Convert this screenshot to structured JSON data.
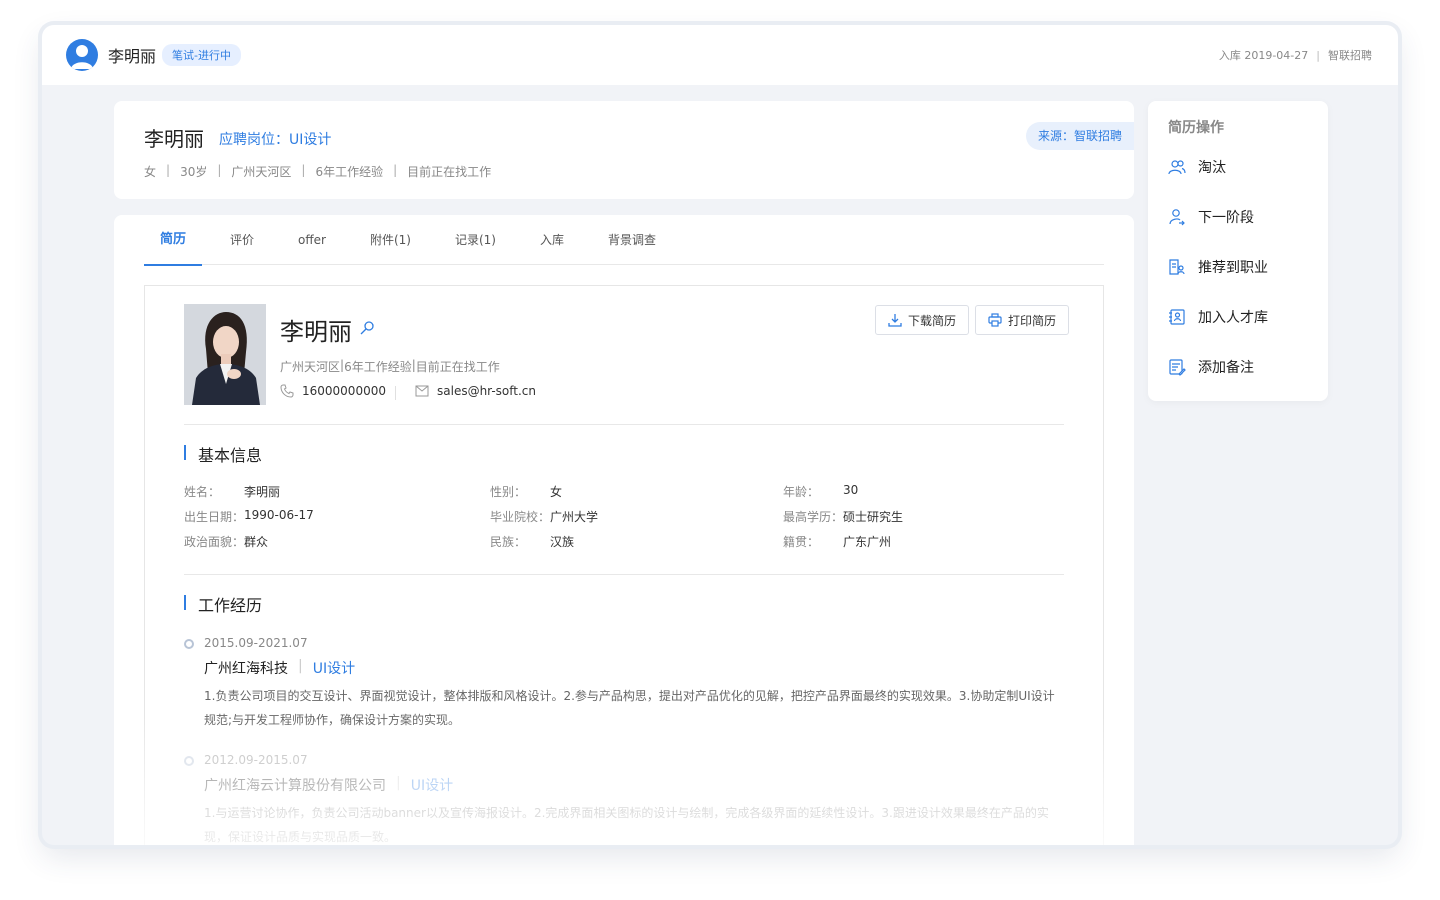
{
  "topbar": {
    "name": "李明丽",
    "status": "笔试-进行中",
    "entry_date": "入库 2019-04-27",
    "sep": "|",
    "source": "智联招聘"
  },
  "summary": {
    "name": "李明丽",
    "position": "应聘岗位：UI设计",
    "source_tag": "来源：智联招聘",
    "meta": [
      "女",
      "30岁",
      "广州天河区",
      "6年工作经验",
      "目前正在找工作"
    ],
    "meta_sep": "|"
  },
  "tabs": [
    {
      "label": "简历"
    },
    {
      "label": "评价"
    },
    {
      "label": "offer"
    },
    {
      "label": "附件(1)"
    },
    {
      "label": "记录(1)"
    },
    {
      "label": "入库"
    },
    {
      "label": "背景调查"
    }
  ],
  "resume": {
    "name": "李明丽",
    "meta": [
      "广州天河区",
      "6年工作经验",
      "目前正在找工作"
    ],
    "phone": "16000000000",
    "email": "sales@hr-soft.cn",
    "download_label": "下载简历",
    "print_label": "打印简历",
    "basic_title": "基本信息",
    "basic_info": [
      [
        [
          "姓名：",
          "李明丽"
        ],
        [
          "性别：",
          "女"
        ],
        [
          "年龄：",
          "30"
        ]
      ],
      [
        [
          "出生日期：",
          "1990-06-17"
        ],
        [
          "毕业院校：",
          "广州大学"
        ],
        [
          "最高学历：",
          "硕士研究生"
        ]
      ],
      [
        [
          "政治面貌：",
          "群众"
        ],
        [
          "民族：",
          "汉族"
        ],
        [
          "籍贯：",
          "广东广州"
        ]
      ]
    ],
    "work_title": "工作经历",
    "work": [
      {
        "date": "2015.09-2021.07",
        "company": "广州红海科技",
        "role": "UI设计",
        "desc": "1.负责公司项目的交互设计、界面视觉设计，整体排版和风格设计。2.参与产品构思，提出对产品优化的见解，把控产品界面最终的实现效果。3.协助定制UI设计规范;与开发工程师协作，确保设计方案的实现。"
      },
      {
        "date": "2012.09-2015.07",
        "company": "广州红海云计算股份有限公司",
        "role": "UI设计",
        "desc": "1.与运营讨论协作，负责公司活动banner以及宣传海报设计。2.完成界面相关图标的设计与绘制，完成各级界面的延续性设计。3.跟进设计效果最终在产品的实现，保证设计品质与实现品质一致。"
      }
    ]
  },
  "sidebar": {
    "title": "简历操作",
    "items": [
      {
        "label": "淘汰",
        "icon": "users-icon"
      },
      {
        "label": "下一阶段",
        "icon": "user-arrow-icon"
      },
      {
        "label": "推荐到职业",
        "icon": "recommend-icon"
      },
      {
        "label": "加入人才库",
        "icon": "talent-pool-icon"
      },
      {
        "label": "添加备注",
        "icon": "note-icon"
      }
    ]
  },
  "colors": {
    "accent": "#2f7de1",
    "badge_bg": "#e6efff"
  }
}
